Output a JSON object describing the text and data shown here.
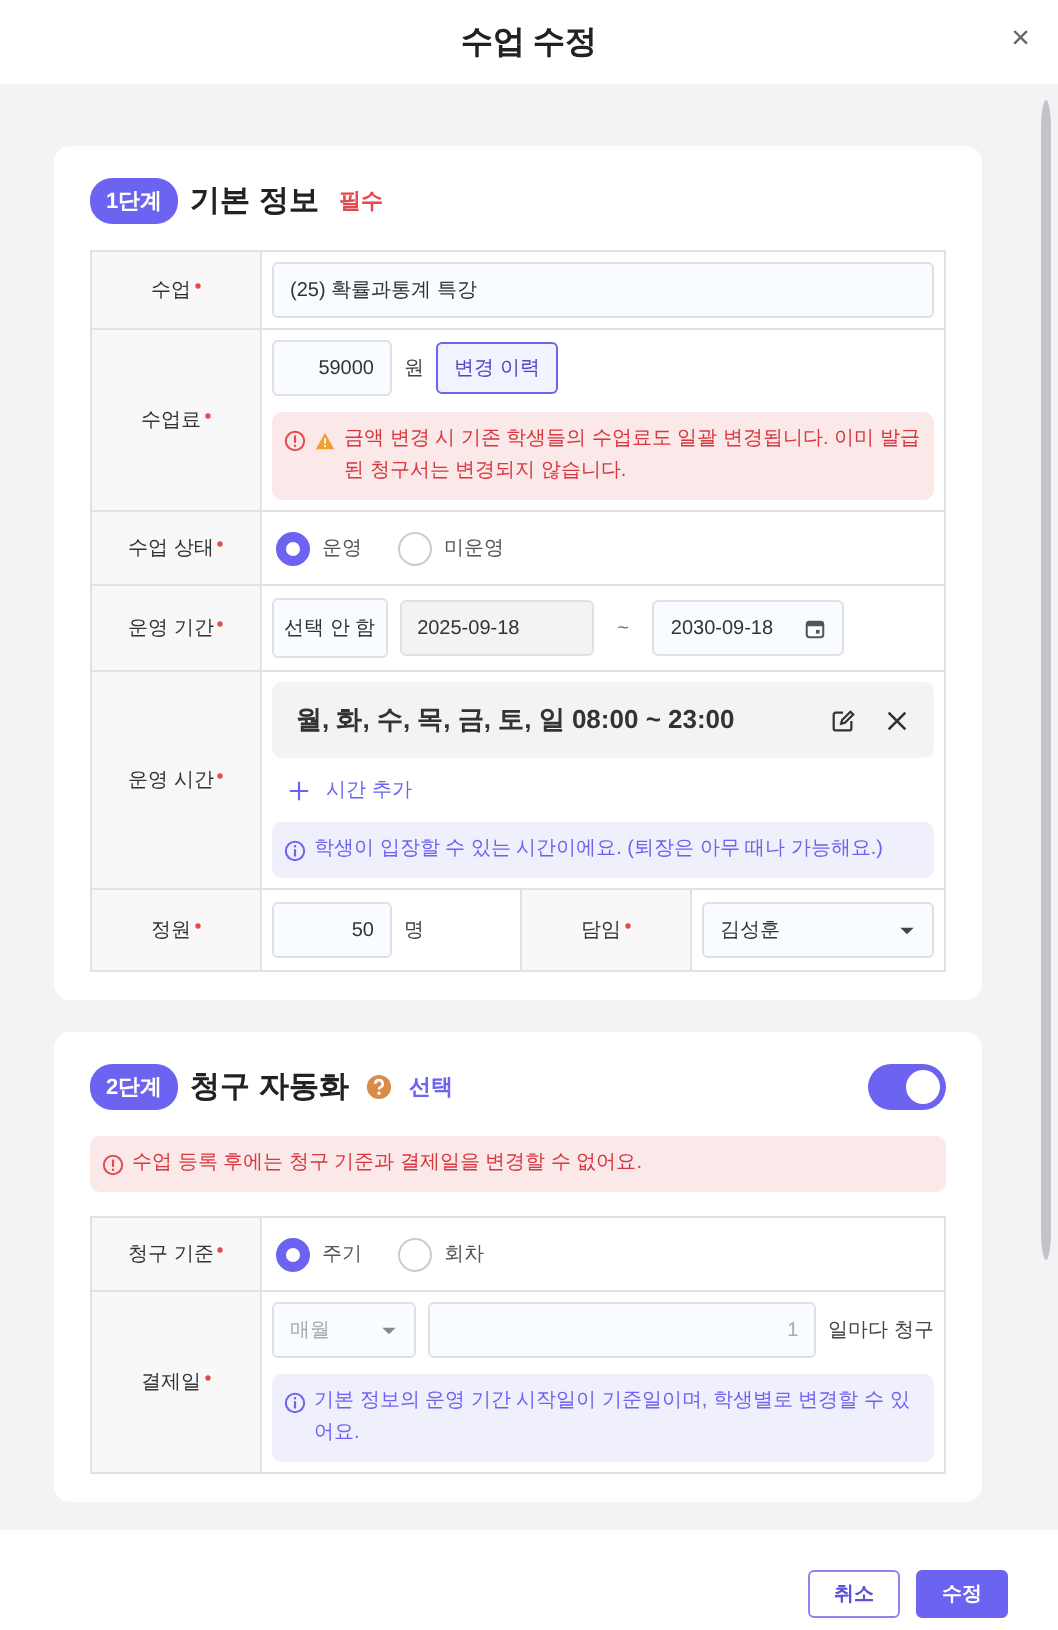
{
  "dialog": {
    "title": "수업 수정",
    "close": "×"
  },
  "basic_info": {
    "step": "1단계",
    "title": "기본 정보",
    "tag": "필수",
    "class": {
      "label": "수업",
      "required": true,
      "value": "(25) 확률과통계 특강"
    },
    "fee": {
      "label": "수업료",
      "required": true,
      "value": "59000",
      "unit": "원",
      "history_button": "변경 이력",
      "warning": "금액 변경 시 기존 학생들의 수업료도 일괄 변경됩니다. 이미 발급된 청구서는 변경되지 않습니다."
    },
    "status": {
      "label": "수업 상태",
      "required": true,
      "options": [
        {
          "label": "운영",
          "selected": true
        },
        {
          "label": "미운영",
          "selected": false
        }
      ]
    },
    "period": {
      "label": "운영 기간",
      "required": true,
      "mode": "선택 안 함",
      "start": "2025-09-18",
      "separator": "~",
      "end": "2030-09-18"
    },
    "hours": {
      "label": "운영 시간",
      "required": true,
      "slots": [
        "월, 화, 수, 목, 금, 토, 일 08:00 ~ 23:00"
      ],
      "add_button": "시간 추가",
      "info": "학생이 입장할 수 있는 시간이에요. (퇴장은 아무 때나 가능해요.)"
    },
    "capacity": {
      "label": "정원",
      "required": true,
      "value": "50",
      "unit": "명"
    },
    "teacher": {
      "label": "담임",
      "required": true,
      "value": "김성훈"
    }
  },
  "billing": {
    "step": "2단계",
    "title": "청구 자동화",
    "tag": "선택",
    "enabled": true,
    "warning": "수업 등록 후에는 청구 기준과 결제일을 변경할 수 없어요.",
    "basis": {
      "label": "청구 기준",
      "required": true,
      "options": [
        {
          "label": "주기",
          "selected": true
        },
        {
          "label": "회차",
          "selected": false
        }
      ]
    },
    "payday": {
      "label": "결제일",
      "required": true,
      "cycle": "매월",
      "day": "1",
      "suffix": "일마다 청구",
      "info": "기본 정보의 운영 기간 시작일이 기준일이며, 학생별로 변경할 수 있어요."
    }
  },
  "footer": {
    "cancel": "취소",
    "submit": "수정"
  }
}
